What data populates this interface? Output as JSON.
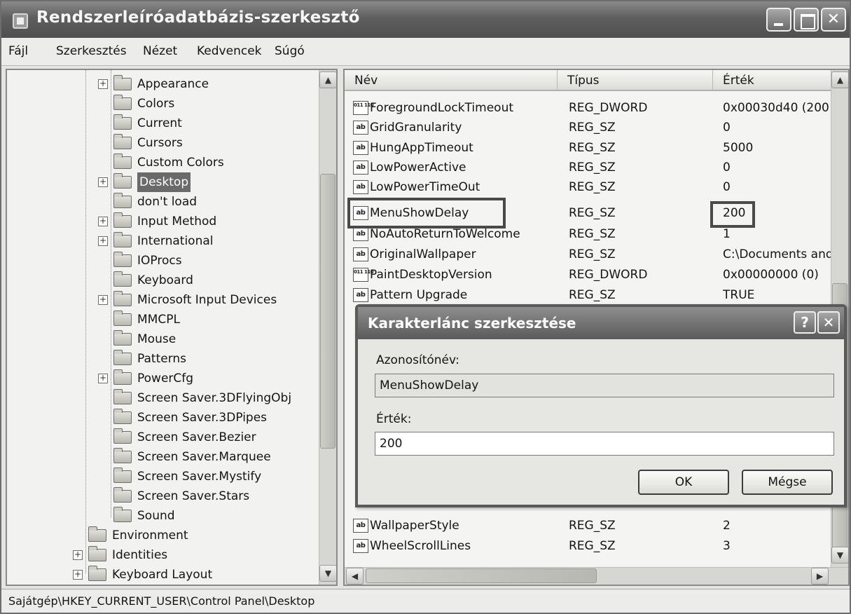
{
  "window": {
    "title": "Rendszerleíróadatbázis-szerkesztő"
  },
  "menu": [
    "Fájl",
    "Szerkesztés",
    "Nézet",
    "Kedvencek",
    "Súgó"
  ],
  "tree": [
    {
      "label": "Appearance",
      "expandable": true,
      "level": 2,
      "selected": false
    },
    {
      "label": "Colors",
      "expandable": false,
      "level": 2,
      "selected": false
    },
    {
      "label": "Current",
      "expandable": false,
      "level": 2,
      "selected": false
    },
    {
      "label": "Cursors",
      "expandable": false,
      "level": 2,
      "selected": false
    },
    {
      "label": "Custom Colors",
      "expandable": false,
      "level": 2,
      "selected": false
    },
    {
      "label": "Desktop",
      "expandable": true,
      "level": 2,
      "selected": true
    },
    {
      "label": "don't load",
      "expandable": false,
      "level": 2,
      "selected": false
    },
    {
      "label": "Input Method",
      "expandable": true,
      "level": 2,
      "selected": false
    },
    {
      "label": "International",
      "expandable": true,
      "level": 2,
      "selected": false
    },
    {
      "label": "IOProcs",
      "expandable": false,
      "level": 2,
      "selected": false
    },
    {
      "label": "Keyboard",
      "expandable": false,
      "level": 2,
      "selected": false
    },
    {
      "label": "Microsoft Input Devices",
      "expandable": true,
      "level": 2,
      "selected": false
    },
    {
      "label": "MMCPL",
      "expandable": false,
      "level": 2,
      "selected": false
    },
    {
      "label": "Mouse",
      "expandable": false,
      "level": 2,
      "selected": false
    },
    {
      "label": "Patterns",
      "expandable": false,
      "level": 2,
      "selected": false
    },
    {
      "label": "PowerCfg",
      "expandable": true,
      "level": 2,
      "selected": false
    },
    {
      "label": "Screen Saver.3DFlyingObj",
      "expandable": false,
      "level": 2,
      "selected": false
    },
    {
      "label": "Screen Saver.3DPipes",
      "expandable": false,
      "level": 2,
      "selected": false
    },
    {
      "label": "Screen Saver.Bezier",
      "expandable": false,
      "level": 2,
      "selected": false
    },
    {
      "label": "Screen Saver.Marquee",
      "expandable": false,
      "level": 2,
      "selected": false
    },
    {
      "label": "Screen Saver.Mystify",
      "expandable": false,
      "level": 2,
      "selected": false
    },
    {
      "label": "Screen Saver.Stars",
      "expandable": false,
      "level": 2,
      "selected": false
    },
    {
      "label": "Sound",
      "expandable": false,
      "level": 2,
      "selected": false
    },
    {
      "label": "Environment",
      "expandable": false,
      "level": 1,
      "selected": false
    },
    {
      "label": "Identities",
      "expandable": true,
      "level": 1,
      "selected": false
    },
    {
      "label": "Keyboard Layout",
      "expandable": true,
      "level": 1,
      "selected": false
    }
  ],
  "list": {
    "columns": [
      "Név",
      "Típus",
      "Érték"
    ],
    "rows": [
      {
        "name": "ForegroundLockTimeout",
        "type": "REG_DWORD",
        "value": "0x00030d40 (200",
        "icon": "dword"
      },
      {
        "name": "GridGranularity",
        "type": "REG_SZ",
        "value": "0",
        "icon": "string"
      },
      {
        "name": "HungAppTimeout",
        "type": "REG_SZ",
        "value": "5000",
        "icon": "string"
      },
      {
        "name": "LowPowerActive",
        "type": "REG_SZ",
        "value": "0",
        "icon": "string"
      },
      {
        "name": "LowPowerTimeOut",
        "type": "REG_SZ",
        "value": "0",
        "icon": "string"
      },
      {
        "name": "MenuShowDelay",
        "type": "REG_SZ",
        "value": "200",
        "icon": "string"
      },
      {
        "name": "NoAutoReturnToWelcome",
        "type": "REG_SZ",
        "value": "1",
        "icon": "string"
      },
      {
        "name": "OriginalWallpaper",
        "type": "REG_SZ",
        "value": "C:\\Documents and",
        "icon": "string"
      },
      {
        "name": "PaintDesktopVersion",
        "type": "REG_DWORD",
        "value": "0x00000000 (0)",
        "icon": "dword"
      },
      {
        "name": "Pattern Upgrade",
        "type": "REG_SZ",
        "value": "TRUE",
        "icon": "string"
      },
      {
        "name": "WallpaperStyle",
        "type": "REG_SZ",
        "value": "2",
        "icon": "string"
      },
      {
        "name": "WheelScrollLines",
        "type": "REG_SZ",
        "value": "3",
        "icon": "string"
      }
    ]
  },
  "dialog": {
    "title": "Karakterlánc szerkesztése",
    "help_glyph": "?",
    "close_glyph": "✕",
    "name_label": "Azonosítónév:",
    "name_value": "MenuShowDelay",
    "value_label": "Érték:",
    "value_value": "200",
    "ok_label": "OK",
    "cancel_label": "Mégse"
  },
  "status": "Sajátgép\\HKEY_CURRENT_USER\\Control Panel\\Desktop",
  "icons": {
    "string": "ab",
    "dword": "011 110"
  }
}
